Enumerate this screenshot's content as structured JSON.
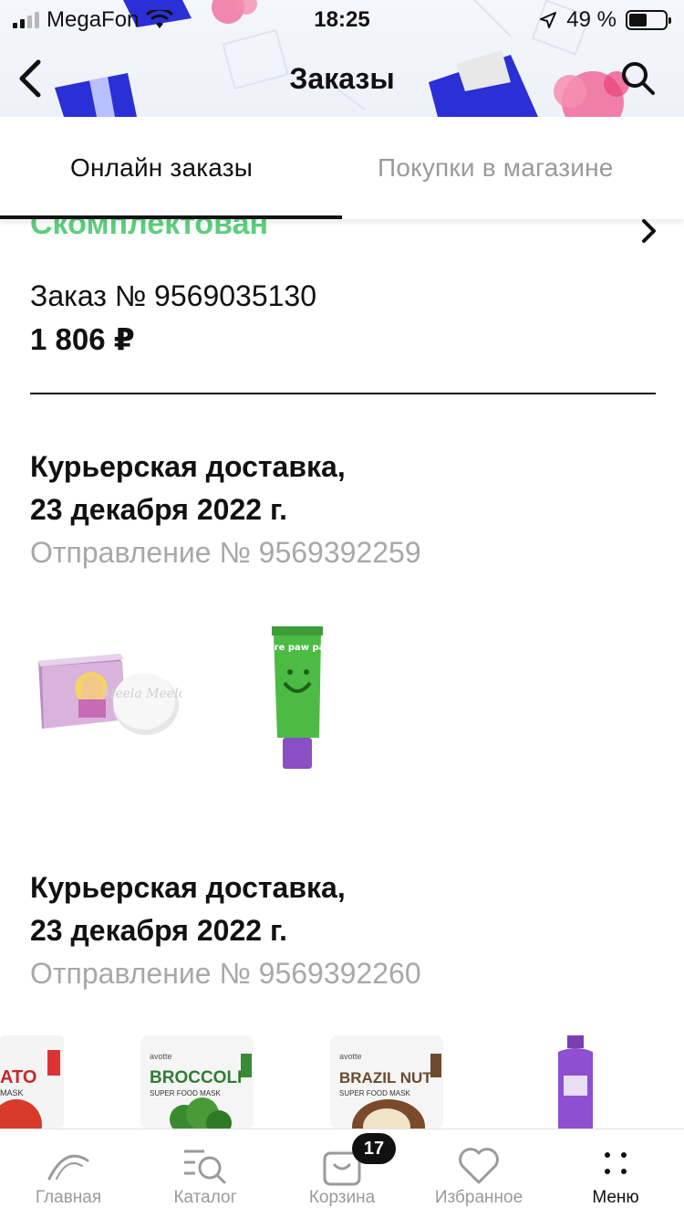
{
  "status_bar": {
    "carrier": "MegaFon",
    "time": "18:25",
    "battery": "49 %",
    "battery_level_percent": 49
  },
  "header": {
    "title": "Заказы"
  },
  "tabs": [
    {
      "label": "Онлайн заказы",
      "active": true
    },
    {
      "label": "Покупки в магазине",
      "active": false
    }
  ],
  "order": {
    "status": "Скомплектован",
    "number": "Заказ № 9569035130",
    "total": "1 806 ₽"
  },
  "shipments": [
    {
      "title_line1": "Курьерская доставка,",
      "title_line2": "23 декабря 2022 г.",
      "number": "Отправление № 9569392259",
      "items": [
        "shampoo-bar-box",
        "lip-balm-tube"
      ]
    },
    {
      "title_line1": "Курьерская доставка,",
      "title_line2": "23 декабря 2022 г.",
      "number": "Отправление № 9569392260",
      "items": [
        "tomato-mask",
        "broccoli-mask",
        "brazil-nut-mask",
        "purple-bottle"
      ]
    }
  ],
  "product_labels": {
    "tomato": "ATO",
    "tomato_sub": "MASK",
    "broccoli_brand": "avotte",
    "broccoli": "BROCCOLI",
    "broccoli_sub": "SUPER FOOD MASK",
    "brazil_brand": "avotte",
    "brazil": "BRAZIL NUT",
    "brazil_sub": "SUPER FOOD MASK",
    "soap_text": "Meela Meelo",
    "balm_text": "pure paw paw"
  },
  "tab_bar": {
    "items": [
      {
        "label": "Главная",
        "icon": "home-arc-icon",
        "active": false
      },
      {
        "label": "Каталог",
        "icon": "catalog-search-icon",
        "active": false
      },
      {
        "label": "Корзина",
        "icon": "cart-bag-icon",
        "active": false,
        "badge": "17"
      },
      {
        "label": "Избранное",
        "icon": "heart-icon",
        "active": false
      },
      {
        "label": "Меню",
        "icon": "menu-dots-icon",
        "active": true
      }
    ]
  },
  "colors": {
    "accent_green": "#5ccf7d",
    "text": "#111111",
    "muted": "#9a9a9a"
  }
}
